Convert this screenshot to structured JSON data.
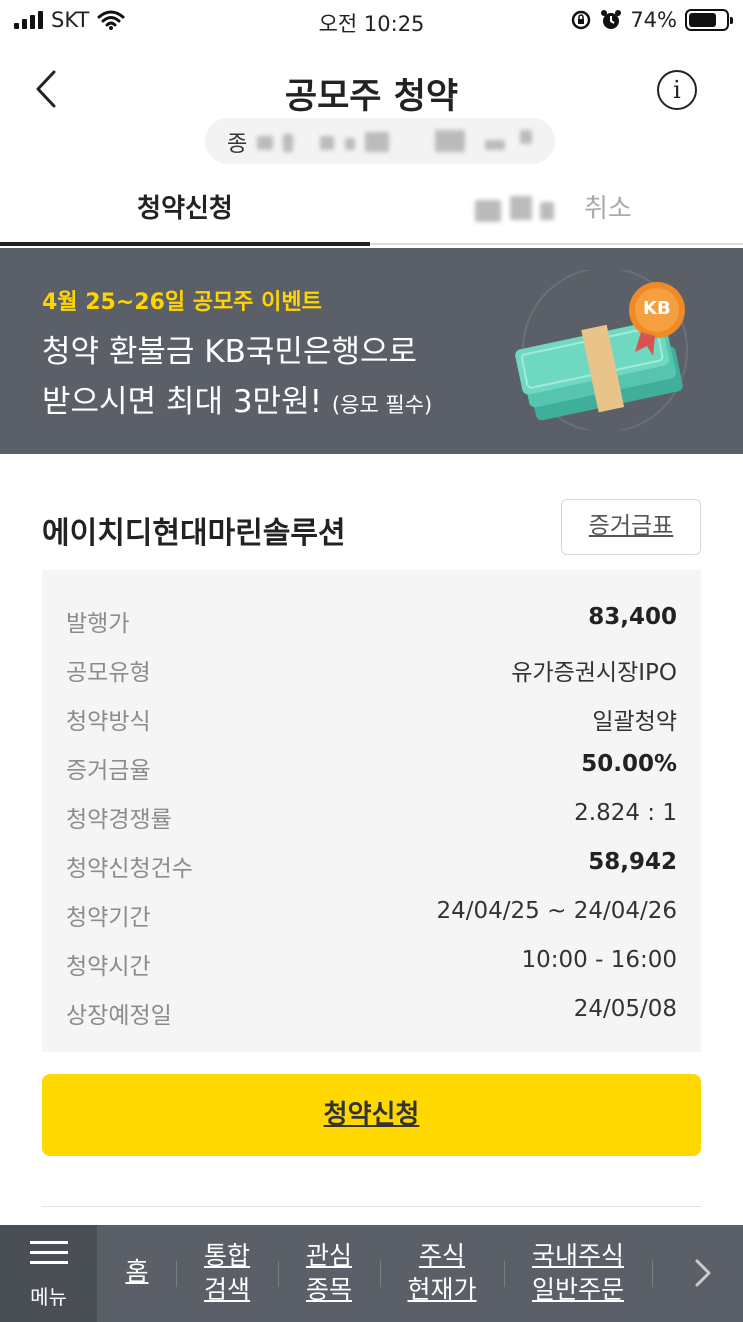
{
  "status_bar": {
    "carrier": "SKT",
    "time": "오전 10:25",
    "battery": "74%",
    "battery_level": 0.74
  },
  "header": {
    "title": "공모주 청약",
    "sub_prefix": "종"
  },
  "tabs": [
    {
      "label": "청약신청",
      "active": true
    },
    {
      "label": "취소",
      "active": false
    }
  ],
  "banner": {
    "eyebrow": "4월 25~26일 공모주 이벤트",
    "line1": "청약 환불금 KB국민은행으로",
    "line2": "받으시면 최대 3만원!",
    "line2_note": "(응모 필수)",
    "badge": "KB"
  },
  "stock": {
    "name": "에이치디현대마린솔루션",
    "proof_button": "증거금표"
  },
  "details": [
    {
      "label": "발행가",
      "value": "83,400",
      "bold": true
    },
    {
      "label": "공모유형",
      "value": "유가증권시장IPO",
      "bold": false
    },
    {
      "label": "청약방식",
      "value": "일괄청약",
      "bold": false
    },
    {
      "label": "증거금율",
      "value": "50.00%",
      "bold": true
    },
    {
      "label": "청약경쟁률",
      "value": "2.824 : 1",
      "bold": false
    },
    {
      "label": "청약신청건수",
      "value": "58,942",
      "bold": true
    },
    {
      "label": "청약기간",
      "value": "24/04/25 ~ 24/04/26",
      "bold": false
    },
    {
      "label": "청약시간",
      "value": "10:00 - 16:00",
      "bold": false
    },
    {
      "label": "상장예정일",
      "value": "24/05/08",
      "bold": false
    }
  ],
  "apply_button": "청약신청",
  "bottom_nav": {
    "menu_label": "메뉴",
    "items": [
      {
        "l1": "홈",
        "l2": ""
      },
      {
        "l1": "통합",
        "l2": "검색"
      },
      {
        "l1": "관심",
        "l2": "종목"
      },
      {
        "l1": "주식",
        "l2": "현재가"
      },
      {
        "l1": "국내주식",
        "l2": "일반주문"
      }
    ]
  },
  "colors": {
    "accent_yellow": "#ffd800",
    "banner_bg": "#5b6068",
    "eyebrow_yellow": "#ffd400"
  }
}
